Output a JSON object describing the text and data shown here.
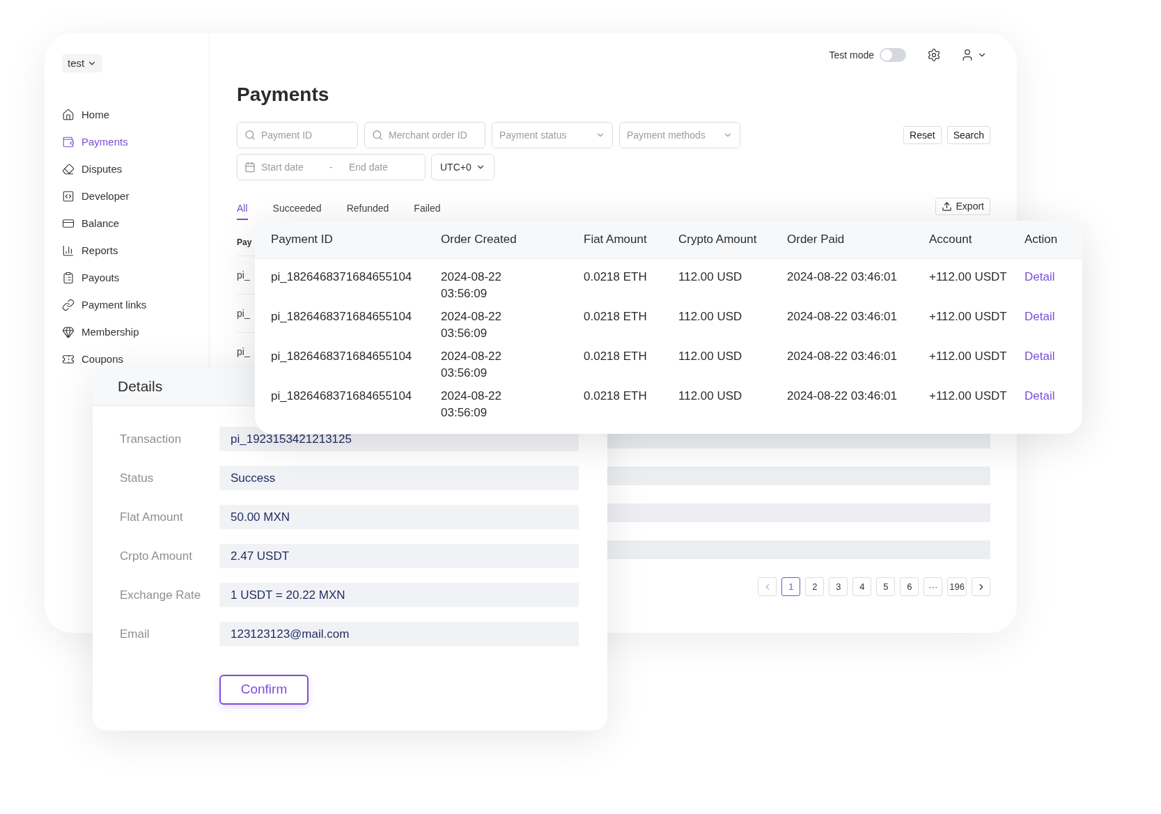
{
  "workspace": {
    "label": "test"
  },
  "sidebar": {
    "items": [
      {
        "label": "Home",
        "selected": false
      },
      {
        "label": "Payments",
        "selected": true
      },
      {
        "label": "Disputes",
        "selected": false
      },
      {
        "label": "Developer",
        "selected": false
      },
      {
        "label": "Balance",
        "selected": false
      },
      {
        "label": "Reports",
        "selected": false
      },
      {
        "label": "Payouts",
        "selected": false
      },
      {
        "label": "Payment links",
        "selected": false
      },
      {
        "label": "Membership",
        "selected": false
      },
      {
        "label": "Coupons",
        "selected": false
      }
    ]
  },
  "header": {
    "test_mode": {
      "label": "Test mode",
      "on": false
    }
  },
  "page_title": "Payments",
  "filters": {
    "fields": [
      {
        "kind": "search",
        "placeholder": "Payment ID"
      },
      {
        "kind": "search",
        "placeholder": "Merchant order ID"
      },
      {
        "kind": "select",
        "placeholder": "Payment status"
      },
      {
        "kind": "select",
        "placeholder": "Payment methods"
      }
    ],
    "date_range": {
      "start_placeholder": "Start date",
      "separator": "-",
      "end_placeholder": "End date"
    },
    "timezone": "UTC+0",
    "buttons": [
      "Reset",
      "Search"
    ]
  },
  "tabs": [
    {
      "label": "All",
      "selected": true
    },
    {
      "label": "Succeeded",
      "selected": false
    },
    {
      "label": "Refunded",
      "selected": false
    },
    {
      "label": "Failed",
      "selected": false
    }
  ],
  "export_button": "Export",
  "background_table": {
    "column_1": "Pay",
    "rows": [
      "pi_",
      "pi_",
      "pi_"
    ]
  },
  "pagination": {
    "pages": [
      {
        "label": "1",
        "selected": true
      },
      {
        "label": "2",
        "selected": false
      },
      {
        "label": "3",
        "selected": false
      },
      {
        "label": "4",
        "selected": false
      },
      {
        "label": "5",
        "selected": false
      },
      {
        "label": "6",
        "selected": false
      },
      {
        "label": "···",
        "selected": false
      },
      {
        "label": "196",
        "selected": false
      }
    ]
  },
  "payments_table": {
    "columns": [
      "Payment ID",
      "Order Created",
      "Fiat Amount",
      "Crypto Amount",
      "Order Paid",
      "Account",
      "Action"
    ],
    "rows": [
      {
        "payment_id": "pi_1826468371684655104",
        "order_created": "2024-08-22 03:56:09",
        "fiat_amount": "0.0218 ETH",
        "crypto_amount": "112.00 USD",
        "order_paid": "2024-08-22 03:46:01",
        "account": "+112.00 USDT",
        "action": "Detail"
      },
      {
        "payment_id": "pi_1826468371684655104",
        "order_created": "2024-08-22 03:56:09",
        "fiat_amount": "0.0218 ETH",
        "crypto_amount": "112.00 USD",
        "order_paid": "2024-08-22 03:46:01",
        "account": "+112.00 USDT",
        "action": "Detail"
      },
      {
        "payment_id": "pi_1826468371684655104",
        "order_created": "2024-08-22 03:56:09",
        "fiat_amount": "0.0218 ETH",
        "crypto_amount": "112.00 USD",
        "order_paid": "2024-08-22 03:46:01",
        "account": "+112.00 USDT",
        "action": "Detail"
      },
      {
        "payment_id": "pi_1826468371684655104",
        "order_created": "2024-08-22 03:56:09",
        "fiat_amount": "0.0218 ETH",
        "crypto_amount": "112.00 USD",
        "order_paid": "2024-08-22 03:46:01",
        "account": "+112.00 USDT",
        "action": "Detail"
      }
    ]
  },
  "details": {
    "title": "Details",
    "fields": [
      {
        "label": "Transaction",
        "value": "pi_1923153421213125"
      },
      {
        "label": "Status",
        "value": "Success"
      },
      {
        "label": "Flat Amount",
        "value": "50.00 MXN"
      },
      {
        "label": "Crpto Amount",
        "value": "2.47 USDT"
      },
      {
        "label": "Exchange Rate",
        "value": "1 USDT = 20.22 MXN"
      },
      {
        "label": "Email",
        "value": "123123123@mail.com"
      }
    ],
    "confirm_button": "Confirm"
  }
}
